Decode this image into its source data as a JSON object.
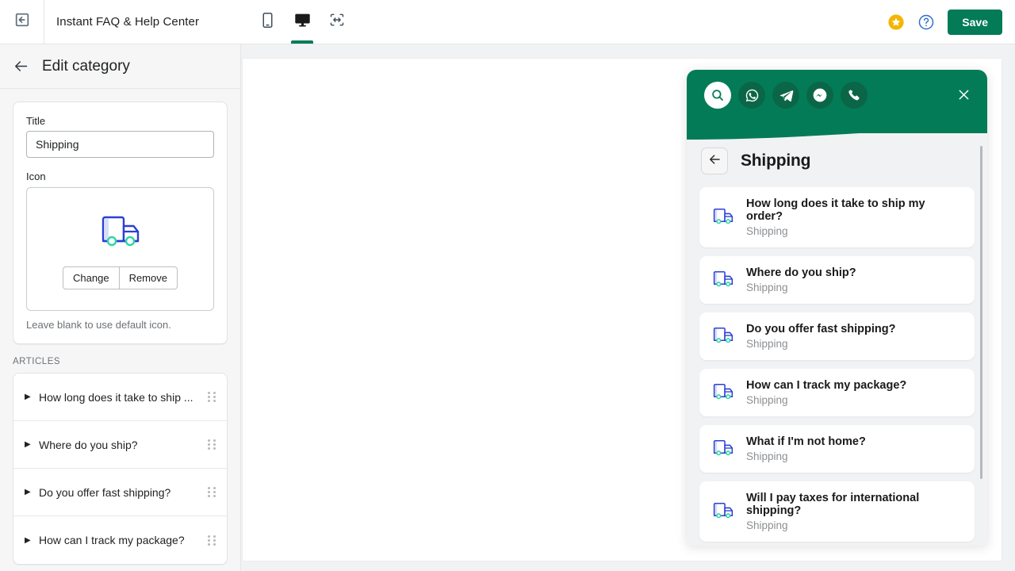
{
  "topbar": {
    "exit_icon": "exit-arrow-icon",
    "app_title": "Instant FAQ & Help Center",
    "devices": [
      {
        "name": "mobile",
        "icon": "mobile-icon",
        "active": false
      },
      {
        "name": "desktop",
        "icon": "desktop-icon",
        "active": true
      },
      {
        "name": "fullwidth",
        "icon": "expand-horizontal-icon",
        "active": false
      }
    ],
    "star_icon": "star-icon",
    "help_icon": "question-mark-icon",
    "save_label": "Save",
    "accent_green": "#047B57",
    "star_color": "#F5B500"
  },
  "sidebar": {
    "back_icon": "arrow-left-icon",
    "title": "Edit category",
    "title_field": {
      "label": "Title",
      "value": "Shipping",
      "placeholder": "Title"
    },
    "icon_field": {
      "label": "Icon",
      "preview_icon": "delivery-truck-icon",
      "change_label": "Change",
      "remove_label": "Remove",
      "help_text": "Leave blank to use default icon."
    },
    "articles_heading": "ARTICLES",
    "articles": [
      {
        "title": "How long does it take to ship ..."
      },
      {
        "title": "Where do you ship?"
      },
      {
        "title": "Do you offer fast shipping?"
      },
      {
        "title": "How can I track my package?"
      }
    ]
  },
  "widget": {
    "header_color": "#047B57",
    "channels": [
      {
        "name": "search-icon",
        "label": "Search"
      },
      {
        "name": "whatsapp-icon",
        "label": "WhatsApp"
      },
      {
        "name": "telegram-icon",
        "label": "Telegram"
      },
      {
        "name": "messenger-icon",
        "label": "Messenger"
      },
      {
        "name": "phone-icon",
        "label": "Phone"
      }
    ],
    "close_icon": "close-icon",
    "back_icon": "arrow-left-icon",
    "title": "Shipping",
    "articles": [
      {
        "question": "How long does it take to ship my order?",
        "category": "Shipping",
        "icon": "delivery-truck-icon"
      },
      {
        "question": "Where do you ship?",
        "category": "Shipping",
        "icon": "delivery-truck-icon"
      },
      {
        "question": "Do you offer fast shipping?",
        "category": "Shipping",
        "icon": "delivery-truck-icon"
      },
      {
        "question": "How can I track my package?",
        "category": "Shipping",
        "icon": "delivery-truck-icon"
      },
      {
        "question": "What if I'm not home?",
        "category": "Shipping",
        "icon": "delivery-truck-icon"
      },
      {
        "question": "Will I pay taxes for international shipping?",
        "category": "Shipping",
        "icon": "delivery-truck-icon"
      }
    ]
  }
}
